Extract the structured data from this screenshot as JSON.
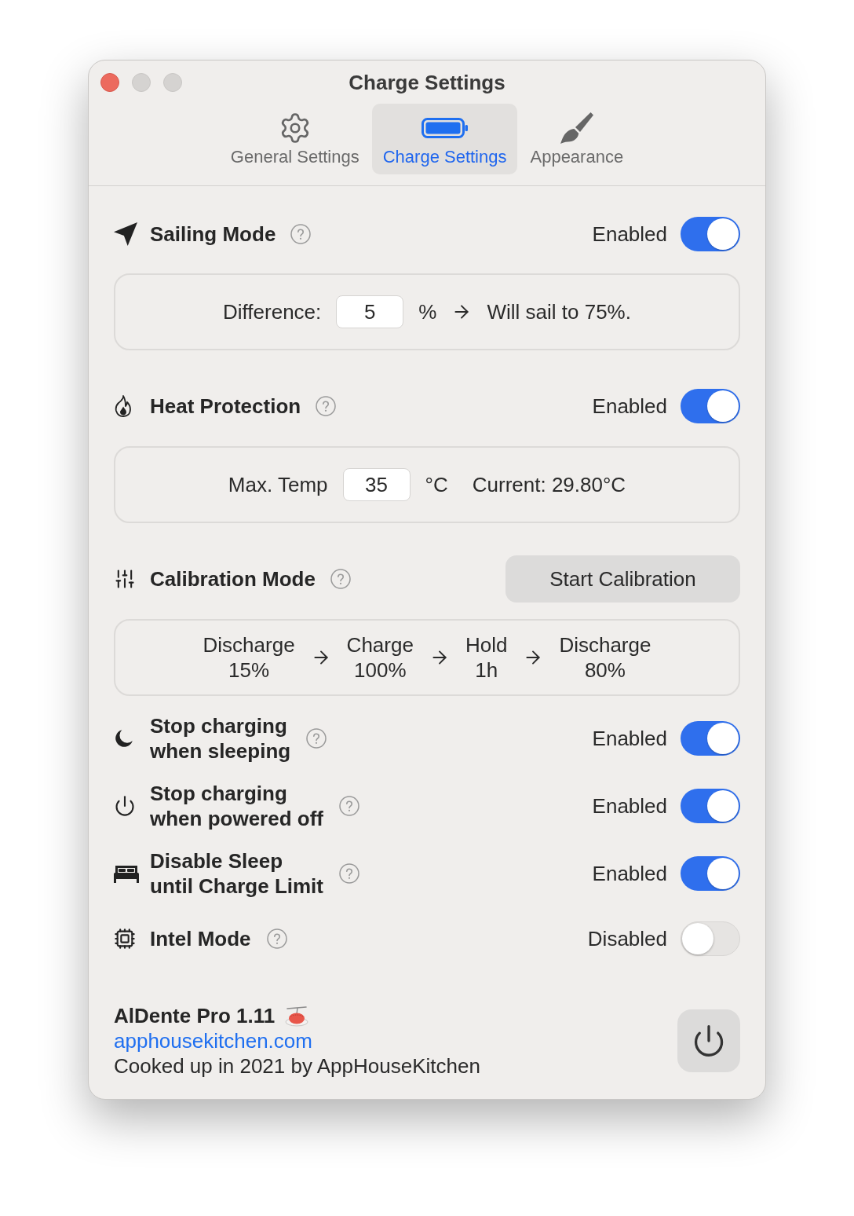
{
  "window": {
    "title": "Charge Settings",
    "buttons": [
      {
        "kind": "close",
        "disabled": false
      },
      {
        "kind": "minimize",
        "disabled": true
      },
      {
        "kind": "zoom",
        "disabled": true
      }
    ]
  },
  "tabs": [
    {
      "label": "General Settings",
      "selected": false
    },
    {
      "label": "Charge Settings",
      "selected": true
    },
    {
      "label": "Appearance",
      "selected": false
    }
  ],
  "sailing_mode": {
    "title": "Sailing Mode",
    "status": "Enabled",
    "on": true,
    "panel": {
      "label": "Difference:",
      "value": "5",
      "unit": "%",
      "result": "Will sail to 75%."
    }
  },
  "heat_protection": {
    "title": "Heat Protection",
    "status": "Enabled",
    "on": true,
    "panel": {
      "label": "Max. Temp",
      "value": "35",
      "unit": "°C",
      "reading": "Current: 29.80°C"
    }
  },
  "calibration_mode": {
    "title": "Calibration Mode",
    "button": "Start Calibration",
    "steps": [
      {
        "action": "Discharge",
        "target": "15%"
      },
      {
        "action": "Charge",
        "target": "100%"
      },
      {
        "action": "Hold",
        "target": "1h"
      },
      {
        "action": "Discharge",
        "target": "80%"
      }
    ]
  },
  "options": [
    {
      "title": "Stop charging\nwhen sleeping",
      "status": "Enabled",
      "on": true
    },
    {
      "title": "Stop charging\nwhen powered off",
      "status": "Enabled",
      "on": true
    },
    {
      "title": "Disable Sleep\nuntil Charge Limit",
      "status": "Enabled",
      "on": true
    },
    {
      "title": "Intel Mode",
      "status": "Disabled",
      "on": false
    }
  ],
  "footer": {
    "app_name": "AlDente Pro 1.11",
    "link": "apphousekitchen.com",
    "credit": "Cooked up in 2021 by AppHouseKitchen"
  }
}
